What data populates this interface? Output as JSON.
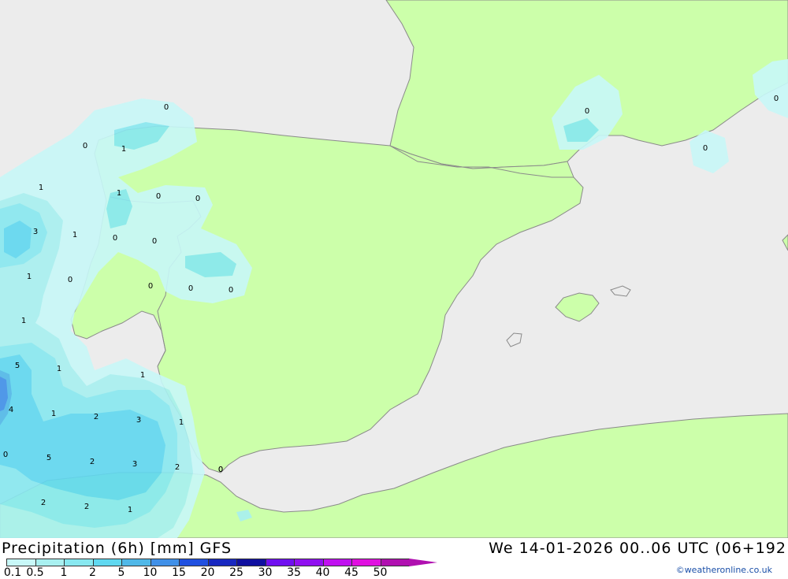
{
  "map": {
    "title": "Precipitation (6h) [mm] GFS",
    "run_info": "We 14-01-2026 00..06 UTC (06+192",
    "credit": "©weatheronline.co.uk",
    "colors": {
      "sea": "#ececec",
      "land": "#ccffaa",
      "coast": "#8a8a8a"
    },
    "legend": {
      "items": [
        {
          "label": "0.1",
          "color": "#c8f8f8"
        },
        {
          "label": "0.5",
          "color": "#a8f0f0"
        },
        {
          "label": "1",
          "color": "#88e8f0"
        },
        {
          "label": "2",
          "color": "#60d8f0"
        },
        {
          "label": "5",
          "color": "#50b8e8"
        },
        {
          "label": "10",
          "color": "#4090e8"
        },
        {
          "label": "15",
          "color": "#2050e0"
        },
        {
          "label": "20",
          "color": "#1828c0"
        },
        {
          "label": "25",
          "color": "#1010a0"
        },
        {
          "label": "30",
          "color": "#7010f0"
        },
        {
          "label": "35",
          "color": "#9010f0"
        },
        {
          "label": "40",
          "color": "#c010f0"
        },
        {
          "label": "45",
          "color": "#e010e0"
        },
        {
          "label": "50",
          "color": "#b010b0"
        }
      ]
    },
    "point_values": [
      "0",
      "0",
      "1",
      "1",
      "1",
      "0",
      "0",
      "3",
      "1",
      "0",
      "0",
      "1",
      "0",
      "0",
      "0",
      "0",
      "1",
      "5",
      "1",
      "1",
      "4",
      "1",
      "2",
      "3",
      "1",
      "0",
      "5",
      "2",
      "3",
      "2",
      "0",
      "2",
      "2",
      "1",
      "0",
      "0",
      "0",
      "0"
    ]
  }
}
